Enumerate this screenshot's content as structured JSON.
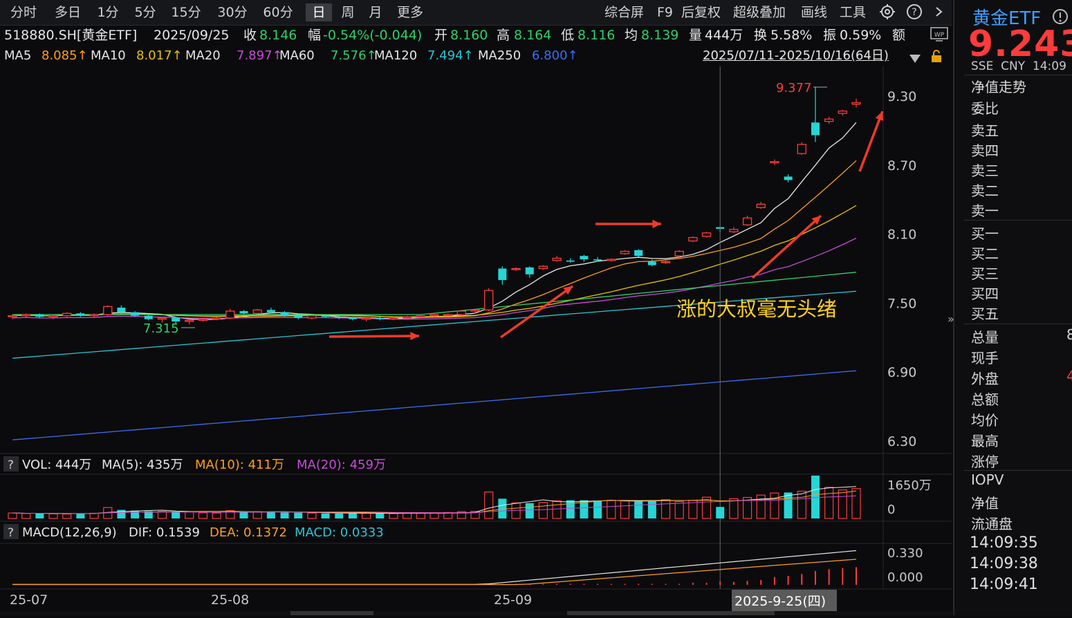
{
  "toolbar": {
    "periods": [
      "分时",
      "多日",
      "1分",
      "5分",
      "15分",
      "30分",
      "60分",
      "日",
      "周",
      "月",
      "更多"
    ],
    "active_period": "日",
    "tools": [
      "综合屏",
      "F9",
      "后复权",
      "超级叠加",
      "画线",
      "工具"
    ],
    "icons": [
      "gear-icon",
      "help-icon",
      "chevron-right-icon"
    ]
  },
  "quote": {
    "symbol": "518880.SH[黄金ETF]",
    "date": "2025/09/25",
    "close_label": "收",
    "close": "8.146",
    "change_label": "幅",
    "change": "-0.54%(-0.044)",
    "open_label": "开",
    "open": "8.160",
    "high_label": "高",
    "high": "8.164",
    "low_label": "低",
    "low": "8.116",
    "avg_label": "均",
    "avg": "8.139",
    "vol_label": "量",
    "vol": "444万",
    "turnover_label": "换",
    "turnover": "5.58%",
    "amplitude_label": "振",
    "amplitude": "0.59%",
    "amount_label": "额"
  },
  "ma_legend": [
    {
      "name": "MA5",
      "value": "8.085↑",
      "color": "#ff9f1a"
    },
    {
      "name": "MA10",
      "value": "8.017↑",
      "color": "#e8c200"
    },
    {
      "name": "MA20",
      "value": "7.897↑",
      "color": "#c84bd8"
    },
    {
      "name": "MA60",
      "value": "7.576↑",
      "color": "#2fd168"
    },
    {
      "name": "MA120",
      "value": "7.494↑",
      "color": "#29c6d6"
    },
    {
      "name": "MA250",
      "value": "6.800↑",
      "color": "#3d6df0"
    }
  ],
  "range_label": "2025/07/11-2025/10/16(64日)",
  "annotation": "涨的大叔毫无头绪",
  "volume_header": {
    "q": "?",
    "vol": "VOL: 444万",
    "ma5": "MA(5): 435万",
    "ma10": "MA(10): 411万",
    "ma20": "MA(20): 459万"
  },
  "macd_header": {
    "q": "?",
    "title": "MACD(12,26,9)",
    "dif": "DIF: 0.1539",
    "dea": "DEA: 0.1372",
    "macd": "MACD: 0.0333"
  },
  "price_axis": [
    "9.30",
    "8.70",
    "8.10",
    "7.50",
    "6.90",
    "6.30"
  ],
  "volume_axis": [
    "1650万",
    "0"
  ],
  "macd_axis": [
    "0.330",
    "0.000"
  ],
  "date_axis": [
    "25-07",
    "25-08",
    "25-09"
  ],
  "crosshair_date": "2025-9-25(四)",
  "marks": {
    "high": "9.377",
    "low": "7.315"
  },
  "right_panel": {
    "name": "黄金ETF",
    "price": "9.243",
    "sub": "SSE  CNY  14:09",
    "labels_top": [
      "净值走势",
      "委比"
    ],
    "sell": [
      "卖五",
      "卖四",
      "卖三",
      "卖二",
      "卖一"
    ],
    "buy": [
      "买一",
      "买二",
      "买三",
      "买四",
      "买五"
    ],
    "stats": [
      "总量",
      "现手",
      "外盘",
      "总额",
      "均价",
      "最高",
      "涨停",
      "IOPV",
      "净值",
      "流通盘"
    ],
    "stats_partial": {
      "总量": "8",
      "外盘": "4"
    },
    "times": [
      "14:09:35",
      "14:09:38",
      "14:09:41"
    ],
    "collapse": "»"
  },
  "chart_data": {
    "type": "candlestick",
    "ylim": [
      6.2,
      9.45
    ],
    "candles": [
      [
        7.38,
        7.4,
        7.36,
        7.39
      ],
      [
        7.39,
        7.41,
        7.37,
        7.4
      ],
      [
        7.4,
        7.41,
        7.37,
        7.38
      ],
      [
        7.38,
        7.4,
        7.36,
        7.39
      ],
      [
        7.39,
        7.42,
        7.38,
        7.41
      ],
      [
        7.41,
        7.42,
        7.38,
        7.39
      ],
      [
        7.39,
        7.41,
        7.37,
        7.4
      ],
      [
        7.4,
        7.48,
        7.39,
        7.47
      ],
      [
        7.46,
        7.48,
        7.41,
        7.42
      ],
      [
        7.42,
        7.43,
        7.38,
        7.39
      ],
      [
        7.39,
        7.4,
        7.35,
        7.36
      ],
      [
        7.36,
        7.38,
        7.33,
        7.37
      ],
      [
        7.37,
        7.38,
        7.32,
        7.34
      ],
      [
        7.34,
        7.36,
        7.315,
        7.35
      ],
      [
        7.35,
        7.37,
        7.34,
        7.36
      ],
      [
        7.36,
        7.38,
        7.35,
        7.37
      ],
      [
        7.37,
        7.45,
        7.36,
        7.43
      ],
      [
        7.43,
        7.44,
        7.4,
        7.41
      ],
      [
        7.41,
        7.45,
        7.4,
        7.44
      ],
      [
        7.44,
        7.46,
        7.41,
        7.42
      ],
      [
        7.42,
        7.43,
        7.38,
        7.39
      ],
      [
        7.39,
        7.4,
        7.36,
        7.37
      ],
      [
        7.37,
        7.4,
        7.36,
        7.39
      ],
      [
        7.39,
        7.4,
        7.37,
        7.38
      ],
      [
        7.38,
        7.39,
        7.36,
        7.37
      ],
      [
        7.37,
        7.38,
        7.35,
        7.36
      ],
      [
        7.36,
        7.38,
        7.34,
        7.37
      ],
      [
        7.37,
        7.39,
        7.35,
        7.36
      ],
      [
        7.36,
        7.38,
        7.35,
        7.37
      ],
      [
        7.37,
        7.39,
        7.36,
        7.38
      ],
      [
        7.38,
        7.4,
        7.36,
        7.39
      ],
      [
        7.39,
        7.41,
        7.38,
        7.4
      ],
      [
        7.4,
        7.41,
        7.39,
        7.4
      ],
      [
        7.4,
        7.44,
        7.39,
        7.43
      ],
      [
        7.43,
        7.45,
        7.41,
        7.44
      ],
      [
        7.44,
        7.63,
        7.43,
        7.61
      ],
      [
        7.8,
        7.82,
        7.66,
        7.7
      ],
      [
        7.8,
        7.81,
        7.78,
        7.8
      ],
      [
        7.81,
        7.82,
        7.72,
        7.75
      ],
      [
        7.8,
        7.83,
        7.79,
        7.82
      ],
      [
        7.87,
        7.91,
        7.86,
        7.89
      ],
      [
        7.87,
        7.89,
        7.85,
        7.86
      ],
      [
        7.91,
        7.92,
        7.86,
        7.88
      ],
      [
        7.88,
        7.9,
        7.86,
        7.87
      ],
      [
        7.87,
        7.89,
        7.86,
        7.88
      ],
      [
        7.93,
        7.96,
        7.92,
        7.95
      ],
      [
        7.96,
        7.97,
        7.9,
        7.91
      ],
      [
        7.86,
        7.88,
        7.82,
        7.83
      ],
      [
        7.86,
        7.88,
        7.84,
        7.86
      ],
      [
        7.91,
        7.96,
        7.9,
        7.95
      ],
      [
        8.04,
        8.08,
        8.03,
        8.07
      ],
      [
        8.08,
        8.12,
        8.07,
        8.11
      ],
      [
        8.16,
        8.164,
        8.116,
        8.146
      ],
      [
        8.12,
        8.16,
        8.11,
        8.14
      ],
      [
        8.18,
        8.26,
        8.17,
        8.24
      ],
      [
        8.33,
        8.38,
        8.32,
        8.36
      ],
      [
        8.72,
        8.75,
        8.7,
        8.73
      ],
      [
        8.6,
        8.62,
        8.55,
        8.57
      ],
      [
        8.8,
        8.9,
        8.79,
        8.88
      ],
      [
        9.07,
        9.377,
        8.9,
        8.96
      ],
      [
        9.08,
        9.12,
        9.06,
        9.1
      ],
      [
        9.15,
        9.18,
        9.13,
        9.17
      ],
      [
        9.23,
        9.28,
        9.2,
        9.243
      ]
    ],
    "volumes": [
      210,
      190,
      200,
      180,
      170,
      190,
      200,
      420,
      330,
      300,
      280,
      270,
      240,
      260,
      220,
      210,
      300,
      240,
      260,
      270,
      230,
      220,
      210,
      200,
      190,
      200,
      210,
      200,
      190,
      200,
      210,
      220,
      230,
      260,
      270,
      1020,
      760,
      600,
      590,
      620,
      680,
      700,
      700,
      680,
      700,
      680,
      690,
      700,
      720,
      650,
      700,
      820,
      444,
      760,
      810,
      900,
      980,
      1000,
      1050,
      1650,
      1200,
      1100,
      1150
    ],
    "macd_bars": [
      0,
      0,
      0,
      0,
      0,
      0,
      0,
      0,
      0,
      0,
      0,
      0,
      0,
      0,
      0,
      0,
      0,
      0,
      0,
      0,
      0,
      0,
      0,
      0,
      0,
      0,
      0,
      0,
      0,
      0,
      0,
      0,
      0,
      0,
      0,
      0.01,
      0.01,
      0.01,
      0.01,
      0.01,
      0.01,
      0.01,
      0.01,
      0.01,
      0.01,
      0.01,
      0.01,
      0.01,
      0.01,
      0.01,
      0.02,
      0.02,
      0.0333,
      0.03,
      0.04,
      0.05,
      0.08,
      0.09,
      0.11,
      0.14,
      0.16,
      0.17,
      0.18
    ]
  }
}
